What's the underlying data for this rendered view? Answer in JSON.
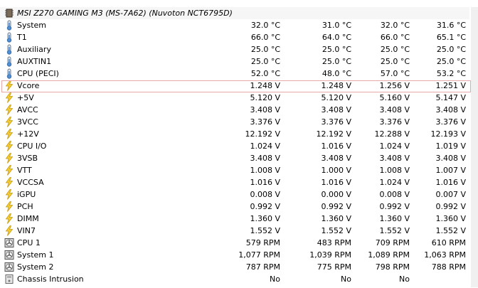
{
  "device": {
    "title": "MSI Z270 GAMING M3 (MS-7A62) (Nuvoton NCT6795D)",
    "icon": "chip-icon"
  },
  "rows": [
    {
      "name": "System",
      "icon": "thermometer-icon",
      "v1": "32.0 °C",
      "v2": "31.0 °C",
      "v3": "32.0 °C",
      "v4": "31.6 °C"
    },
    {
      "name": "T1",
      "icon": "thermometer-icon",
      "v1": "66.0 °C",
      "v2": "64.0 °C",
      "v3": "66.0 °C",
      "v4": "65.1 °C"
    },
    {
      "name": "Auxiliary",
      "icon": "thermometer-icon",
      "v1": "25.0 °C",
      "v2": "25.0 °C",
      "v3": "25.0 °C",
      "v4": "25.0 °C"
    },
    {
      "name": "AUXTIN1",
      "icon": "thermometer-icon",
      "v1": "25.0 °C",
      "v2": "25.0 °C",
      "v3": "25.0 °C",
      "v4": "25.0 °C"
    },
    {
      "name": "CPU (PECI)",
      "icon": "thermometer-icon",
      "v1": "52.0 °C",
      "v2": "48.0 °C",
      "v3": "57.0 °C",
      "v4": "53.2 °C"
    },
    {
      "name": "Vcore",
      "icon": "lightning-icon",
      "v1": "1.248 V",
      "v2": "1.248 V",
      "v3": "1.256 V",
      "v4": "1.251 V",
      "selected": true
    },
    {
      "name": "+5V",
      "icon": "lightning-icon",
      "v1": "5.120 V",
      "v2": "5.120 V",
      "v3": "5.160 V",
      "v4": "5.147 V"
    },
    {
      "name": "AVCC",
      "icon": "lightning-icon",
      "v1": "3.408 V",
      "v2": "3.408 V",
      "v3": "3.408 V",
      "v4": "3.408 V"
    },
    {
      "name": "3VCC",
      "icon": "lightning-icon",
      "v1": "3.376 V",
      "v2": "3.376 V",
      "v3": "3.376 V",
      "v4": "3.376 V"
    },
    {
      "name": "+12V",
      "icon": "lightning-icon",
      "v1": "12.192 V",
      "v2": "12.192 V",
      "v3": "12.288 V",
      "v4": "12.193 V"
    },
    {
      "name": "CPU I/O",
      "icon": "lightning-icon",
      "v1": "1.024 V",
      "v2": "1.016 V",
      "v3": "1.024 V",
      "v4": "1.019 V"
    },
    {
      "name": "3VSB",
      "icon": "lightning-icon",
      "v1": "3.408 V",
      "v2": "3.408 V",
      "v3": "3.408 V",
      "v4": "3.408 V"
    },
    {
      "name": "VTT",
      "icon": "lightning-icon",
      "v1": "1.008 V",
      "v2": "1.000 V",
      "v3": "1.008 V",
      "v4": "1.007 V"
    },
    {
      "name": "VCCSA",
      "icon": "lightning-icon",
      "v1": "1.016 V",
      "v2": "1.016 V",
      "v3": "1.024 V",
      "v4": "1.016 V"
    },
    {
      "name": "iGPU",
      "icon": "lightning-icon",
      "v1": "0.008 V",
      "v2": "0.000 V",
      "v3": "0.008 V",
      "v4": "0.007 V"
    },
    {
      "name": "PCH",
      "icon": "lightning-icon",
      "v1": "0.992 V",
      "v2": "0.992 V",
      "v3": "0.992 V",
      "v4": "0.992 V"
    },
    {
      "name": "DIMM",
      "icon": "lightning-icon",
      "v1": "1.360 V",
      "v2": "1.360 V",
      "v3": "1.360 V",
      "v4": "1.360 V"
    },
    {
      "name": "VIN7",
      "icon": "lightning-icon",
      "v1": "1.552 V",
      "v2": "1.552 V",
      "v3": "1.552 V",
      "v4": "1.552 V"
    },
    {
      "name": "CPU 1",
      "icon": "fan-icon",
      "v1": "579 RPM",
      "v2": "483 RPM",
      "v3": "709 RPM",
      "v4": "610 RPM"
    },
    {
      "name": "System 1",
      "icon": "fan-icon",
      "v1": "1,077 RPM",
      "v2": "1,039 RPM",
      "v3": "1,089 RPM",
      "v4": "1,063 RPM"
    },
    {
      "name": "System 2",
      "icon": "fan-icon",
      "v1": "787 RPM",
      "v2": "775 RPM",
      "v3": "798 RPM",
      "v4": "788 RPM"
    },
    {
      "name": "Chassis Intrusion",
      "icon": "chassis-icon",
      "v1": "No",
      "v2": "No",
      "v3": "No",
      "v4": ""
    }
  ],
  "colors": {
    "selection_border": "#e8a9ab",
    "header_bg": "#f6f6f6",
    "grid": "#f0f0f0"
  }
}
